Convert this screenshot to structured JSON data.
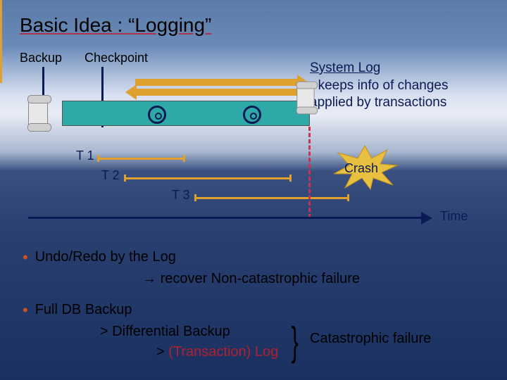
{
  "title": "Basic Idea : “Logging”",
  "labels": {
    "backup": "Backup",
    "checkpoint": "Checkpoint",
    "time": "Time",
    "crash": "Crash"
  },
  "system_log": {
    "heading": "System Log",
    "desc1": "- keeps info of changes",
    "desc2": "applied by transactions"
  },
  "transactions": {
    "t1": "T 1",
    "t2": "T 2",
    "t3": "T 3"
  },
  "bullets": {
    "b1": "Undo/Redo by the Log",
    "b1_sub_arrow": "→",
    "b1_sub": "recover Non-catastrophic failure",
    "b2": "Full DB Backup",
    "b2_sub1": "> Differential Backup",
    "b2_sub2_gt": "> ",
    "b2_sub2_paren": "(Transaction) Log",
    "catastrophic": "Catastrophic failure"
  },
  "icons": {
    "scroll": "scroll-icon",
    "disk": "disk-icon",
    "star": "starburst-icon"
  }
}
